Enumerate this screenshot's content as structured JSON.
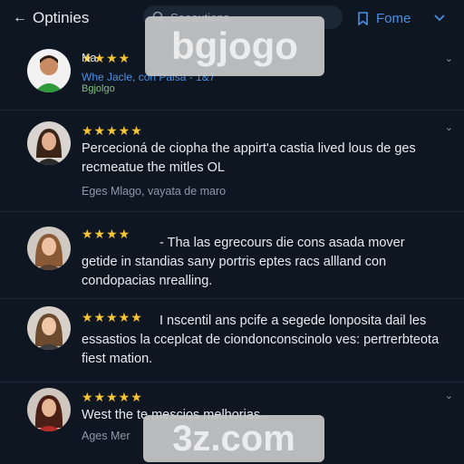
{
  "header": {
    "back_label": "Optinies",
    "search_placeholder": "Seeautions",
    "filter_label": "Fome"
  },
  "reviews": [
    {
      "stars": "★★★★",
      "name": "Na",
      "company": "Whe Jacle, con Paisa - 1&7",
      "verified": "Bgjolgo"
    },
    {
      "stars": "★★★★★",
      "text": "Percecioná de ciopha the appirt'a castia lived lous de ges recmeatue the mitles OL",
      "meta": "Eges   Mlago, vayata de maro"
    },
    {
      "stars": "★★★★",
      "text": "- Tha las egrecours die cons asada mover getide in standias sany portris eptes racs allland con condopacias nrealling."
    },
    {
      "stars": "★★★★★",
      "text": "I nscentil ans pcife a segede lonposita dail les essastios la cceplcat de ciondonconscinolo ves: pertrerbteota fiest mation."
    },
    {
      "stars": "★★★★★",
      "text": "West the te                                  mescios melhorias.",
      "meta": "Ages   Mer"
    }
  ],
  "overlays": {
    "top": "bgjogo",
    "bottom": "3z.com"
  },
  "colors": {
    "background": "#0e1622",
    "accent": "#4a90e2",
    "star": "#f7c531",
    "muted": "#8e99a8"
  }
}
